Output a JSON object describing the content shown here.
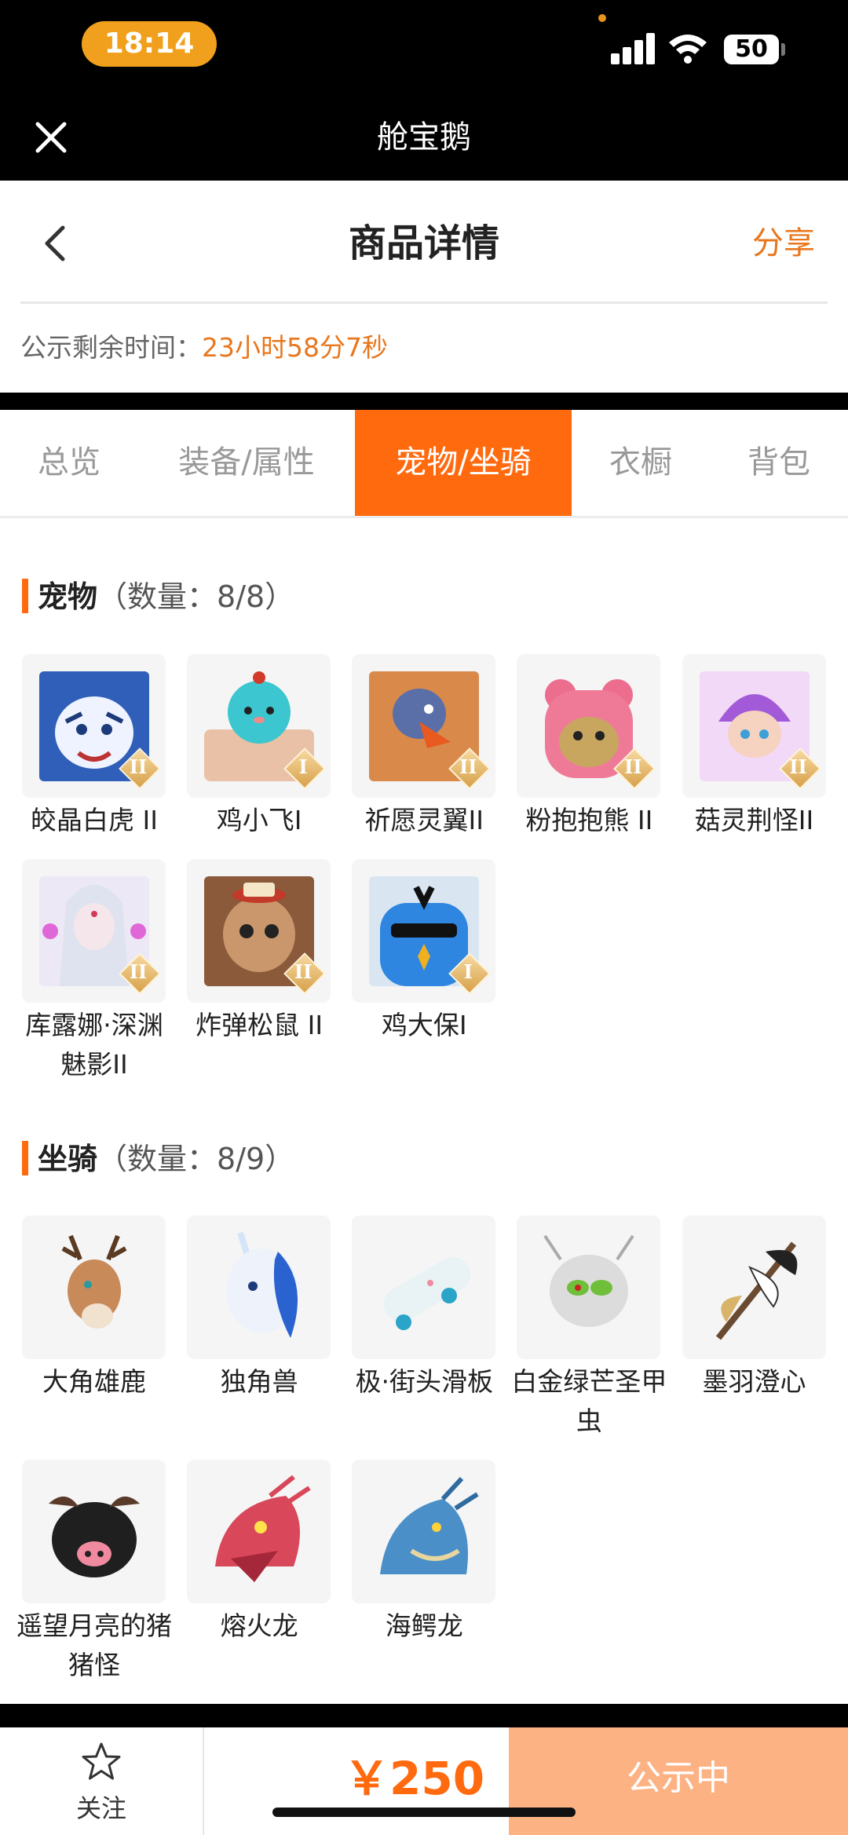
{
  "status_bar": {
    "time": "18:14",
    "battery": "50"
  },
  "app": {
    "title": "舱宝鹅"
  },
  "header": {
    "title": "商品详情",
    "share_label": "分享"
  },
  "countdown": {
    "label": "公示剩余时间：",
    "value": "23小时58分7秒"
  },
  "tabs": [
    {
      "label": "总览",
      "active": false
    },
    {
      "label": "装备/属性",
      "active": false
    },
    {
      "label": "宠物/坐骑",
      "active": true
    },
    {
      "label": "衣橱",
      "active": false
    },
    {
      "label": "背包",
      "active": false
    }
  ],
  "pets": {
    "title": "宠物",
    "count": "（数量：8/8）",
    "items": [
      {
        "name": "皎晶白虎 II",
        "badge": "II",
        "icon": "white-tiger"
      },
      {
        "name": "鸡小飞I",
        "badge": "I",
        "icon": "blue-chick"
      },
      {
        "name": "祈愿灵翼II",
        "badge": "II",
        "icon": "eagle"
      },
      {
        "name": "粉抱抱熊 II",
        "badge": "II",
        "icon": "pink-bear"
      },
      {
        "name": "菇灵荆怪II",
        "badge": "II",
        "icon": "purple-sprite"
      },
      {
        "name": "库露娜·深渊魅影II",
        "badge": "II",
        "icon": "white-spirit"
      },
      {
        "name": "炸弹松鼠 II",
        "badge": "II",
        "icon": "squirrel"
      },
      {
        "name": "鸡大保I",
        "badge": "I",
        "icon": "blue-bird"
      }
    ]
  },
  "mounts": {
    "title": "坐骑",
    "count": "（数量：8/9）",
    "items": [
      {
        "name": "大角雄鹿",
        "icon": "stag"
      },
      {
        "name": "独角兽",
        "icon": "unicorn"
      },
      {
        "name": "极·街头滑板",
        "icon": "skateboard"
      },
      {
        "name": "白金绿芒圣甲虫",
        "icon": "beetle"
      },
      {
        "name": "墨羽澄心",
        "icon": "feather-sword"
      },
      {
        "name": "遥望月亮的猪猪怪",
        "icon": "black-pig"
      },
      {
        "name": "熔火龙",
        "icon": "red-dragon"
      },
      {
        "name": "海鳄龙",
        "icon": "blue-dragon"
      }
    ]
  },
  "bottom": {
    "follow_label": "关注",
    "price": "￥250",
    "status_label": "公示中"
  },
  "colors": {
    "accent": "#ff6a0f",
    "accent_light": "#fdb284",
    "link": "#e8771e"
  }
}
